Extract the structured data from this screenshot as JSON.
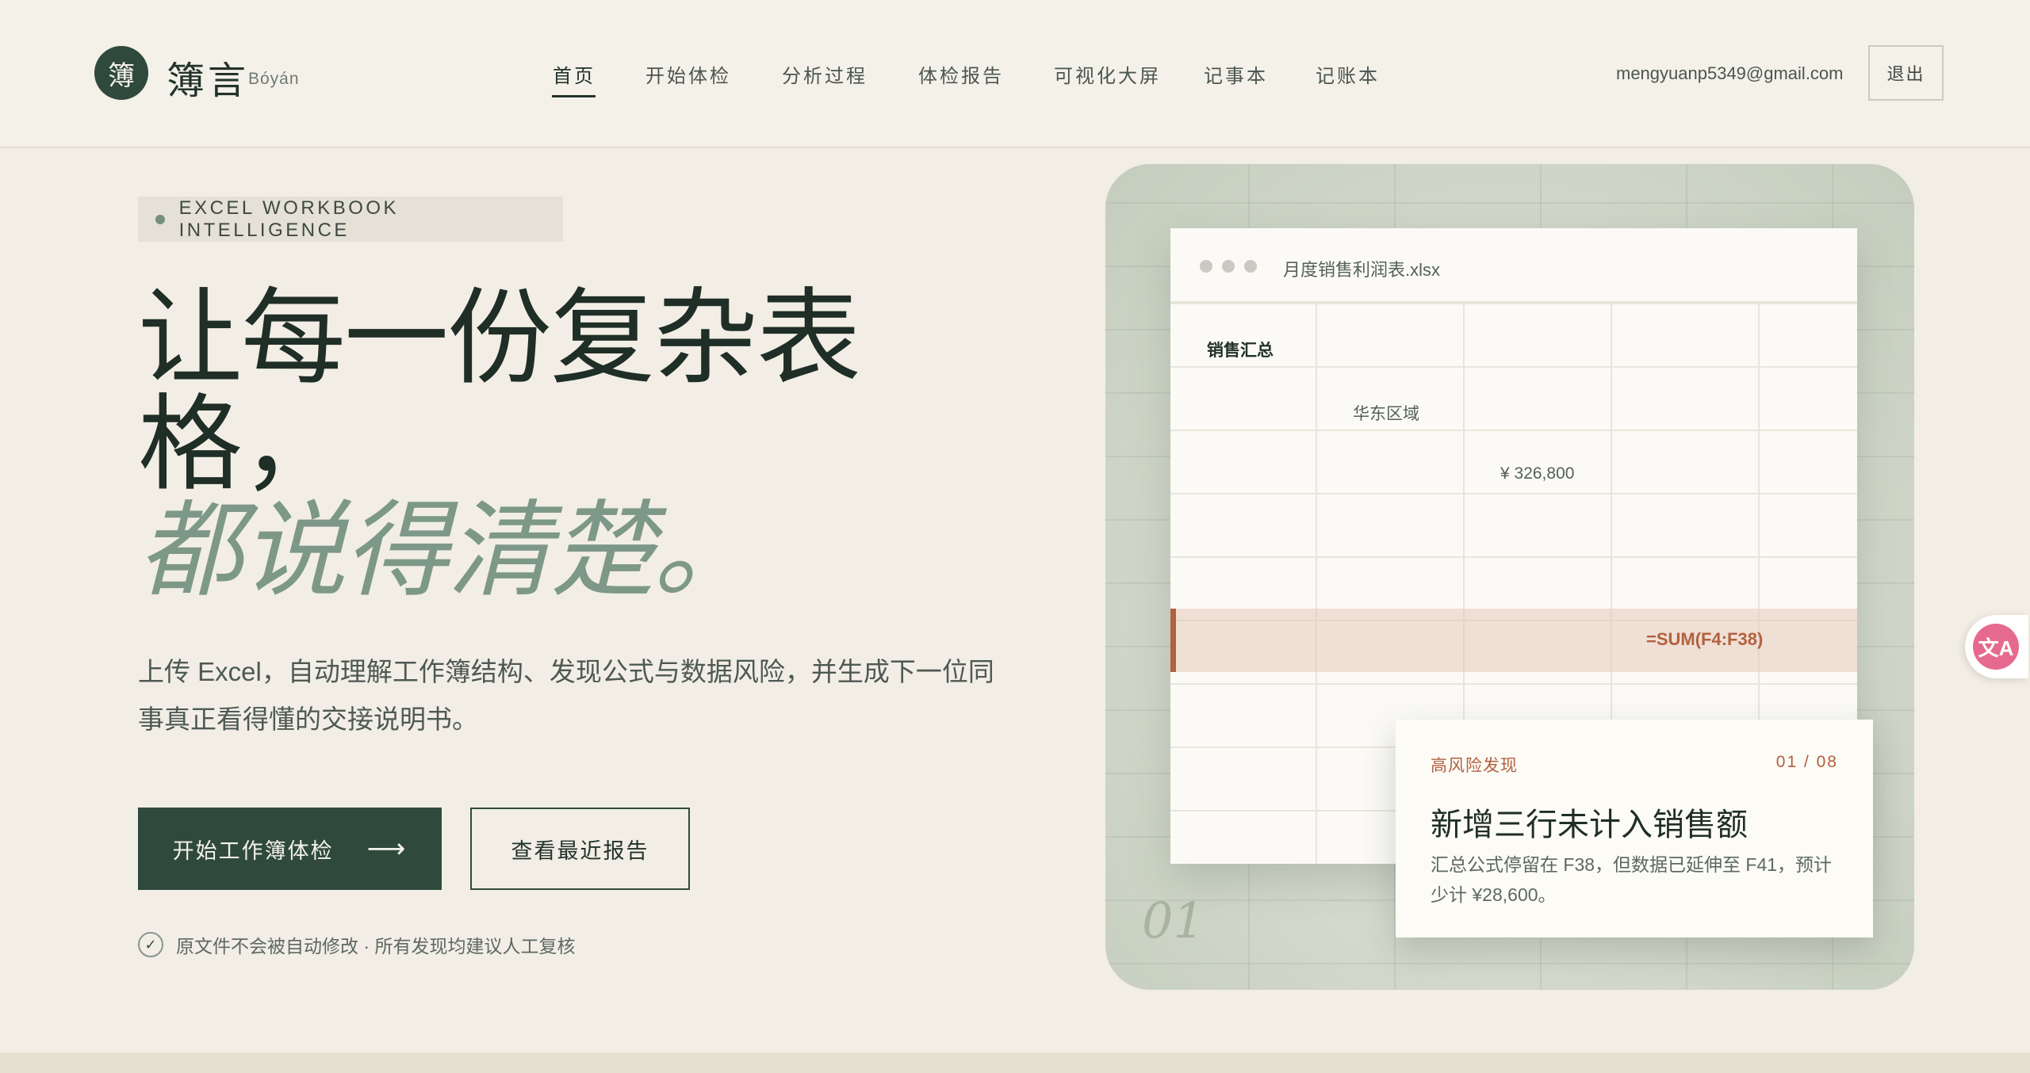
{
  "brand": {
    "mark": "簿",
    "name": "簿言",
    "romanized": "Bóyán"
  },
  "nav": {
    "items": [
      {
        "label": "首页",
        "active": true
      },
      {
        "label": "开始体检",
        "active": false
      },
      {
        "label": "分析过程",
        "active": false
      },
      {
        "label": "体检报告",
        "active": false
      },
      {
        "label": "可视化大屏",
        "active": false
      },
      {
        "label": "记事本",
        "active": false
      },
      {
        "label": "记账本",
        "active": false
      }
    ]
  },
  "user": {
    "email": "mengyuanp5349@gmail.com",
    "logout_label": "退出"
  },
  "hero": {
    "eyebrow": "EXCEL WORKBOOK INTELLIGENCE",
    "headline_line1": "让每一份复杂表格，",
    "headline_line2": "都说得清楚。",
    "subtitle": "上传 Excel，自动理解工作簿结构、发现公式与数据风险，并生成下一位同事真正看得懂的交接说明书。",
    "primary_button": "开始工作簿体检",
    "primary_button_icon": "arrow-right-icon",
    "secondary_button": "查看最近报告",
    "note": "原文件不会被自动修改 · 所有发现均建议人工复核"
  },
  "preview": {
    "index_label": "01",
    "sheet": {
      "filename": "月度销售利润表.xlsx",
      "section_title": "销售汇总",
      "region": "华东区域",
      "amount": "¥ 326,800",
      "formula": "=SUM(F4:F38)"
    },
    "risk_card": {
      "tag": "高风险发现",
      "counter": "01 / 08",
      "title": "新增三行未计入销售额",
      "description": "汇总公式停留在 F38，但数据已延伸至 F41，预计少计 ¥28,600。"
    }
  },
  "colors": {
    "brand_green": "#2f4a3d",
    "accent_sage": "#7d9886",
    "risk_terracotta": "#b2613f",
    "background": "#f2eee5"
  },
  "floating": {
    "translate_icon": "translate-icon"
  }
}
